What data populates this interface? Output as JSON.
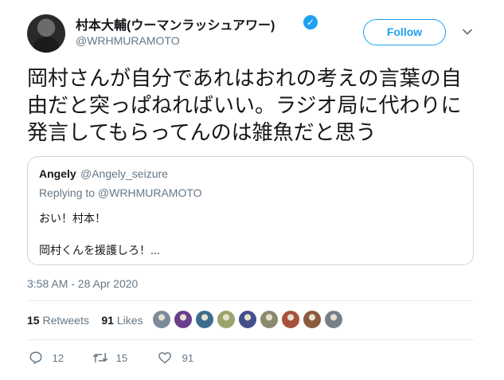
{
  "author": {
    "display_name": "村本大輔(ウーマンラッシュアワー)",
    "handle": "@WRHMURAMOTO"
  },
  "follow_label": "Follow",
  "tweet_text": "岡村さんが自分であれはおれの考えの言葉の自由だと突っぱねればいい。ラジオ局に代わりに発言してもらってんのは雑魚だと思う",
  "quoted": {
    "name": "Angely",
    "handle": "@Angely_seizure",
    "replying_to": "Replying to @WRHMURAMOTO",
    "line1": "おい！村本！",
    "line2": "岡村くんを援護しろ！..."
  },
  "timestamp": "3:58 AM - 28 Apr 2020",
  "stats": {
    "retweets_count": "15",
    "retweets_label": "Retweets",
    "likes_count": "91",
    "likes_label": "Likes"
  },
  "liker_colors": [
    "#7d8a99",
    "#6a3f8c",
    "#3e6c8f",
    "#9aa36b",
    "#45508a",
    "#8a8a6f",
    "#a7523a",
    "#8b5a3c",
    "#778088"
  ],
  "actions": {
    "replies": "12",
    "retweets": "15",
    "likes": "91"
  },
  "colors": {
    "accent": "#1da1f2",
    "muted": "#657786",
    "border": "#ccd6dd"
  }
}
